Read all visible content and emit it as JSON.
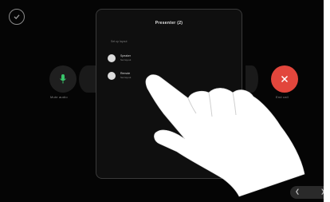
{
  "panel": {
    "title": "Presenter (2)",
    "section_label": "Set up layout",
    "options": [
      {
        "title": "Speaker",
        "subtitle": "Set layout"
      },
      {
        "title": "Remote",
        "subtitle": "Set layout"
      }
    ]
  },
  "call_controls": {
    "mic_label": "Mute audio",
    "end_label": "End call"
  },
  "colors": {
    "screen_bg": "#050505",
    "panel_bg": "#0f0f0f",
    "end_call": "#e2463c",
    "hand": "#ffffff"
  },
  "icons": {
    "check": "check-circle-icon",
    "mic": "microphone-icon",
    "end": "close-icon",
    "nav_left": "chevron-left-icon",
    "nav_right": "chevron-right-icon"
  }
}
